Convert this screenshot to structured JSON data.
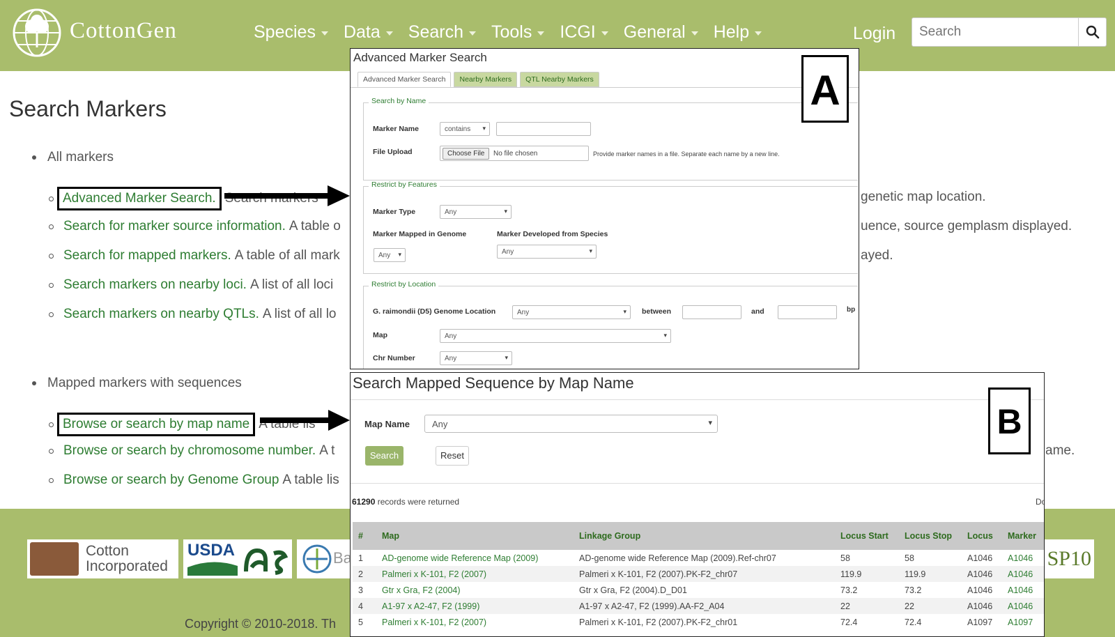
{
  "header": {
    "brand": "CottonGen",
    "nav": [
      "Species",
      "Data",
      "Search",
      "Tools",
      "ICGI",
      "General",
      "Help"
    ],
    "login": "Login",
    "search_placeholder": "Search"
  },
  "page": {
    "title": "Search Markers",
    "section1": "All markers",
    "section2": "Mapped markers with sequences",
    "links": [
      {
        "text": "Advanced Marker Search.",
        "desc": "Search markers",
        "tail": "genetic map location."
      },
      {
        "text": "Search for marker source information.",
        "desc": "A table o",
        "tail": "uence, source gemplasm displayed."
      },
      {
        "text": "Search for mapped markers.",
        "desc": "A table of all mark",
        "tail": "ayed."
      },
      {
        "text": "Search markers on nearby loci.",
        "desc": "A list of all loci"
      },
      {
        "text": "Search markers on nearby QTLs.",
        "desc": "A list of all lo"
      }
    ],
    "links2": [
      {
        "text": "Browse or search by map name",
        "desc": "A table lis"
      },
      {
        "text": "Browse or search by chromosome number.",
        "desc": "A t",
        "tail": "ame."
      },
      {
        "text": "Browse or search by Genome Group",
        "desc": "A table lis"
      }
    ]
  },
  "footer": {
    "cotton_line1": "Cotton",
    "cotton_line2": "Incorporated",
    "usda": "USDA",
    "bayer_frag": "Ba",
    "sp10": "SP10",
    "copyright": "Copyright © 2010-2018. Th"
  },
  "panelA": {
    "label": "A",
    "title": "Advanced Marker Search",
    "tabs": [
      "Advanced Marker Search",
      "Nearby Markers",
      "QTL Nearby Markers"
    ],
    "legend_name": "Search by Name",
    "marker_name_label": "Marker Name",
    "marker_name_op": "contains",
    "file_upload_label": "File Upload",
    "choose_file": "Choose File",
    "no_file": "No file chosen",
    "upload_hint": "Provide marker names in a file. Separate each name by a new line.",
    "legend_features": "Restrict by Features",
    "marker_type_label": "Marker Type",
    "marker_type_val": "Any",
    "mapped_genome_label": "Marker Mapped in Genome",
    "mapped_genome_val": "Any",
    "dev_species_label": "Marker Developed from Species",
    "dev_species_val": "Any",
    "legend_location": "Restrict by Location",
    "genome_loc_label": "G. raimondii (D5) Genome Location",
    "genome_loc_val": "Any",
    "between": "between",
    "and": "and",
    "bp": "bp",
    "map_label": "Map",
    "map_val": "Any",
    "chr_label": "Chr Number",
    "chr_val": "Any"
  },
  "panelB": {
    "label": "B",
    "title": "Search Mapped Sequence by Map Name",
    "map_name_label": "Map Name",
    "map_name_val": "Any",
    "search_btn": "Search",
    "reset_btn": "Reset",
    "count": "61290",
    "count_suffix": "records were returned",
    "do_frag": "Do",
    "columns": [
      "#",
      "Map",
      "Linkage Group",
      "Locus Start",
      "Locus Stop",
      "Locus",
      "Marker"
    ],
    "rows": [
      [
        "1",
        "AD-genome wide Reference Map (2009)",
        "AD-genome wide Reference Map (2009).Ref-chr07",
        "58",
        "58",
        "A1046",
        "A1046"
      ],
      [
        "2",
        "Palmeri x K-101, F2 (2007)",
        "Palmeri x K-101, F2 (2007).PK-F2_chr07",
        "119.9",
        "119.9",
        "A1046",
        "A1046"
      ],
      [
        "3",
        "Gtr x Gra, F2 (2004)",
        "Gtr x Gra, F2 (2004).D_D01",
        "73.2",
        "73.2",
        "A1046",
        "A1046"
      ],
      [
        "4",
        "A1-97 x A2-47, F2 (1999)",
        "A1-97 x A2-47, F2 (1999).AA-F2_A04",
        "22",
        "22",
        "A1046",
        "A1046"
      ],
      [
        "5",
        "Palmeri x K-101, F2 (2007)",
        "Palmeri x K-101, F2 (2007).PK-F2_chr01",
        "72.4",
        "72.4",
        "A1097",
        "A1097"
      ]
    ]
  }
}
